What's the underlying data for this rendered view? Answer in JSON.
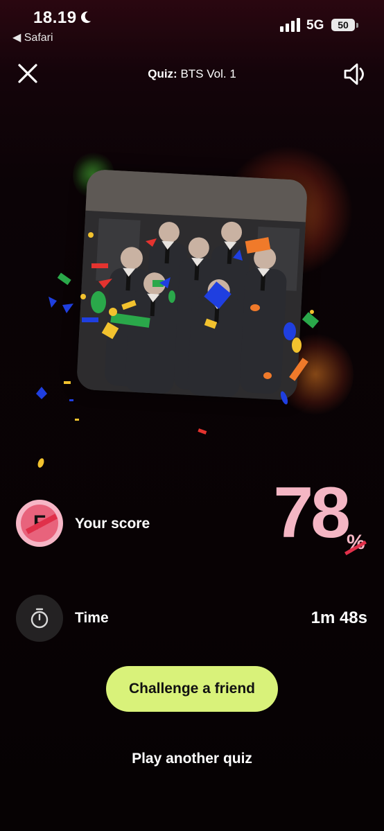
{
  "status_bar": {
    "time": "18.19",
    "back_app": "◀ Safari",
    "network": "5G",
    "battery": "50"
  },
  "header": {
    "title_label": "Quiz:",
    "title_name": "BTS Vol. 1"
  },
  "results": {
    "score_label": "Your score",
    "score_value": "78",
    "score_unit": "%",
    "score_icon_letter": "F",
    "time_label": "Time",
    "time_value": "1m 48s"
  },
  "actions": {
    "challenge_label": "Challenge a friend",
    "play_another_label": "Play another quiz"
  },
  "colors": {
    "accent_button": "#d9f27a",
    "score_pink": "#f4b6c4",
    "score_icon_red": "#e8637c"
  },
  "icons": {
    "close": "close-icon",
    "sound": "speaker-icon",
    "timer": "stopwatch-icon",
    "moon": "moon-icon",
    "signal": "signal-icon"
  }
}
